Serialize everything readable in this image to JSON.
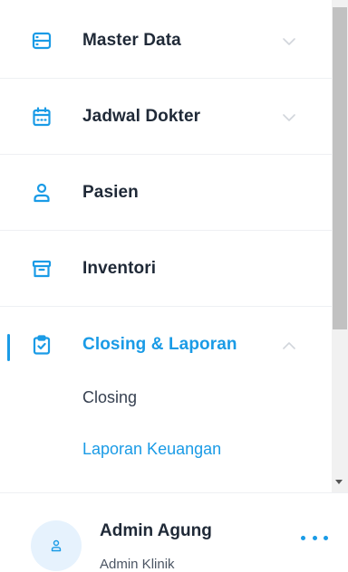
{
  "nav": {
    "items": [
      {
        "label": "Master Data",
        "icon": "server-icon",
        "expandable": true,
        "expanded": false
      },
      {
        "label": "Jadwal Dokter",
        "icon": "calendar-icon",
        "expandable": true,
        "expanded": false
      },
      {
        "label": "Pasien",
        "icon": "user-icon",
        "expandable": false
      },
      {
        "label": "Inventori",
        "icon": "archive-icon",
        "expandable": false
      },
      {
        "label": "Closing & Laporan",
        "icon": "clipboard-check-icon",
        "expandable": true,
        "expanded": true,
        "active": true,
        "children": [
          {
            "label": "Closing",
            "selected": false
          },
          {
            "label": "Laporan Keuangan",
            "selected": true
          }
        ]
      }
    ]
  },
  "profile": {
    "name": "Admin Agung",
    "role": "Admin Klinik",
    "avatar_icon": "user-icon",
    "more_icon": "more-horizontal-icon"
  },
  "colors": {
    "accent": "#1a9be6",
    "text": "#1f2937",
    "muted": "#4b5563",
    "divider": "#eef0f3",
    "avatar_bg": "#e6f2fd"
  }
}
